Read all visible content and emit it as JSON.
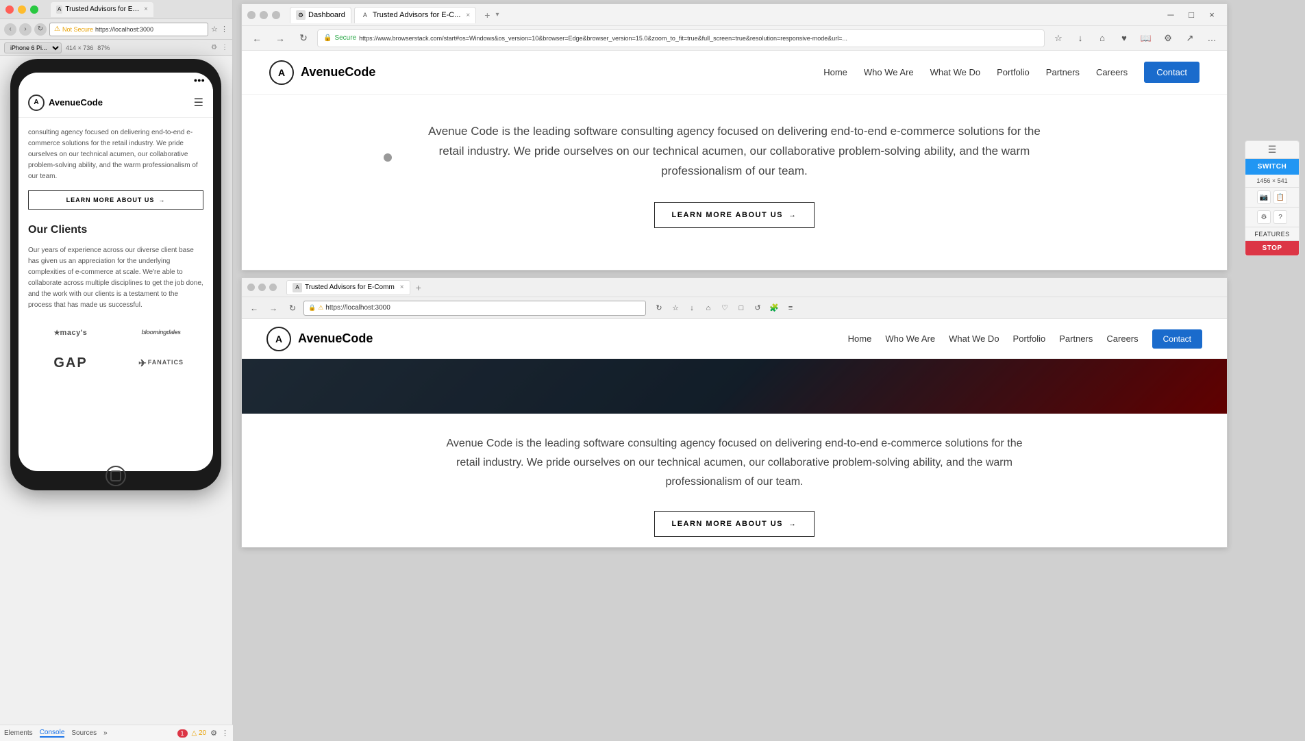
{
  "leftWindow": {
    "title": "Trusted Advisors for E-Comm...",
    "macButtons": [
      "close",
      "minimize",
      "maximize"
    ],
    "addressBar": {
      "warning": "Not Secure",
      "url": "https://localhost:3000",
      "icon": "⚠"
    },
    "viewport": {
      "device": "iPhone 6 Pi...",
      "dimensions": "414 × 736",
      "zoom": "87%"
    },
    "phone": {
      "logoText": "AvenueCode",
      "logoLetter": "A",
      "heroText": "consulting agency focused on delivering end-to-end e-commerce solutions for the retail industry. We pride ourselves on our technical acumen, our collaborative problem-solving ability, and the warm professionalism of our team.",
      "ctaButton": "LEARN MORE ABOUT US →",
      "clientsHeading": "Our Clients",
      "clientsText": "Our years of experience across our diverse client base has given us an appreciation for the underlying complexities of e-commerce at scale. We're able to collaborate across multiple disciplines to get the job done, and the work with our clients is a testament to the process that has made us successful.",
      "clients": [
        {
          "name": "★ macy's",
          "style": "macys"
        },
        {
          "name": "bloomingdales",
          "style": "bloomingdales"
        },
        {
          "name": "GAP",
          "style": "gap"
        },
        {
          "name": "FANATICS",
          "style": "fanatics"
        }
      ]
    },
    "devtools": {
      "tabs": [
        "Elements",
        "Console",
        "Sources"
      ],
      "activeTab": "Console",
      "errors": "1",
      "warnings": "20",
      "moreIcon": "»"
    }
  },
  "topBrowser": {
    "title": "Dashboard",
    "tabLabel": "Trusted Advisors for E-C...",
    "addressBar": {
      "secure": true,
      "secureText": "Secure",
      "url": "https://www.browserstack.com/start#os=Windows&os_version=10&browser=Edge&browser_version=15.0&zoom_to_fit=true&full_screen=true&resolution=responsive-mode&url=..."
    },
    "site": {
      "logoLetter": "A",
      "logoText": "AvenueCode",
      "nav": {
        "links": [
          "Home",
          "Who We Are",
          "What We Do",
          "Portfolio",
          "Partners",
          "Careers"
        ],
        "ctaButton": "Contact"
      },
      "hero": {
        "body": "Avenue Code is the leading software consulting agency focused on delivering end-to-end e-commerce solutions for the retail industry. We pride ourselves on our technical acumen, our collaborative problem-solving ability, and the warm professionalism of our team.",
        "ctaButton": "LEARN MORE ABOUT US →"
      }
    }
  },
  "bottomBrowser": {
    "title": "Trusted Advisors for E-Comm",
    "tabLabel": "Trusted Advisors for E-Comm",
    "addressBar": {
      "warning": true,
      "url": "https://localhost:3000"
    },
    "site": {
      "logoLetter": "A",
      "logoText": "AvenueCode",
      "nav": {
        "links": [
          "Home",
          "Who We Are",
          "What We Do",
          "Portfolio",
          "Partners",
          "Careers"
        ],
        "ctaButton": "Contact"
      },
      "heroImage": true,
      "hero": {
        "body": "Avenue Code is the leading software consulting agency focused on delivering end-to-end e-commerce solutions for the retail industry. We pride ourselves on our technical acumen, our collaborative problem-solving ability, and the warm professionalism of our team.",
        "ctaButton": "LEARN MORE ABOUT US →"
      }
    }
  },
  "bsPanel": {
    "switchButton": "SWITCH",
    "resolution": "1456 × 541",
    "featuresButton": "FEATURES",
    "stopButton": "STOP",
    "icons": [
      "📷",
      "⚙",
      "?",
      "📋"
    ]
  },
  "icons": {
    "back": "←",
    "forward": "→",
    "refresh": "↻",
    "close": "×",
    "star": "☆",
    "lock": "🔒",
    "warning": "⚠",
    "home": "⌂",
    "bookmark": "🔖",
    "settings": "⚙",
    "more": "⋯",
    "hamburger": "☰",
    "arrow_right": "→"
  }
}
